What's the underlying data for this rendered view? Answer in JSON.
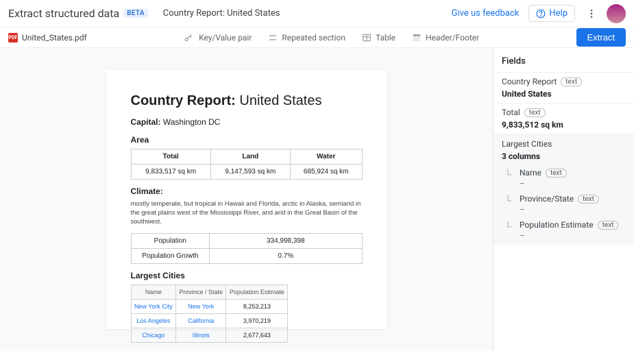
{
  "header": {
    "title": "Extract structured data",
    "beta": "BETA",
    "subtitle": "Country Report: United States",
    "feedback": "Give us feedback",
    "help": "Help"
  },
  "toolbar": {
    "filename": "United_States.pdf",
    "tools": {
      "kv": "Key/Value pair",
      "repeated": "Repeated section",
      "table": "Table",
      "hf": "Header/Footer"
    },
    "extract": "Extract"
  },
  "doc": {
    "h1_bold": "Country Report:",
    "h1_rest": " United States",
    "capital_label": "Capital:",
    "capital_value": " Washington DC",
    "area_label": "Area",
    "area_headers": {
      "total": "Total",
      "land": "Land",
      "water": "Water"
    },
    "area_values": {
      "total": "9,833,517 sq km",
      "land": "9,147,593 sq km",
      "water": "685,924 sq km"
    },
    "climate_label": "Climate:",
    "climate_text": "mostly temperate, but tropical in Hawaii and Florida, arctic in Alaska, semiarid in the great plains west of the Mississippi River, and arid in the Great Basin of the southwest.",
    "pop_label": "Population",
    "pop_value": "334,998,398",
    "popg_label": "Population Growth",
    "popg_value": "0.7%",
    "cities_label": "Largest Cities",
    "cities_headers": {
      "name": "Name",
      "province": "Province / State",
      "est": "Population Estimate"
    },
    "cities": [
      {
        "name": "New York City",
        "province": "New York",
        "est": "8,253,213"
      },
      {
        "name": "Los Angeles",
        "province": "California",
        "est": "3,970,219"
      },
      {
        "name": "Chicago",
        "province": "Illinois",
        "est": "2,677,643"
      }
    ]
  },
  "panel": {
    "title": "Fields",
    "type_text": "text",
    "fields": {
      "f1_label": "Country Report",
      "f1_value": "United States",
      "f2_label": "Total",
      "f2_value": "9,833,512 sq km"
    },
    "nested": {
      "title": "Largest Cities",
      "columns": "3 columns",
      "c1": "Name",
      "c2": "Province/State",
      "c3": "Population Estimate",
      "dash": "–"
    }
  }
}
